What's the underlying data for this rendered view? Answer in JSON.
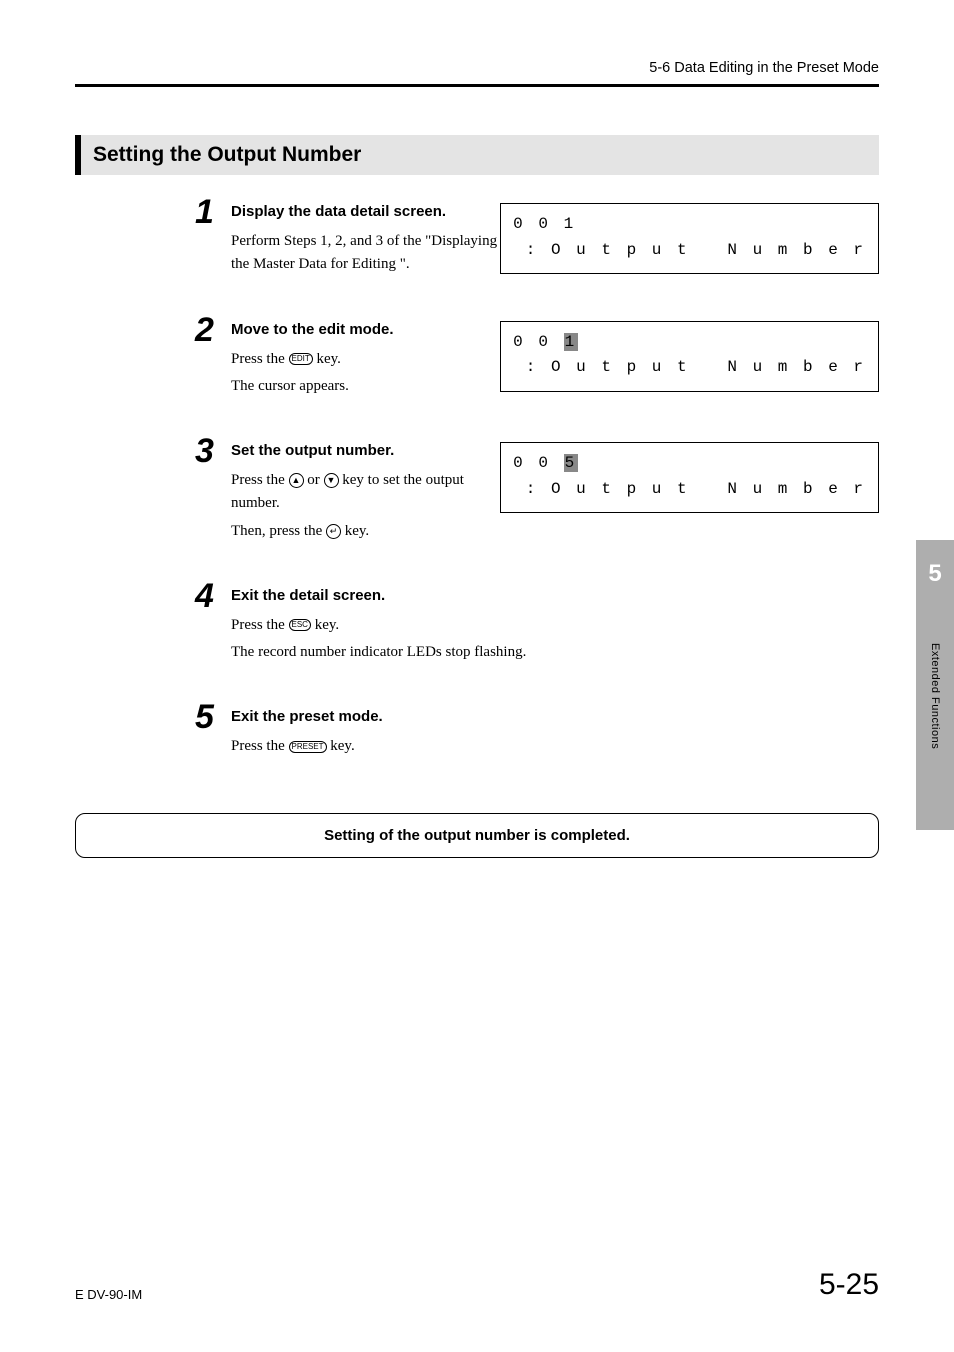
{
  "header": {
    "chapter_label": "5-6  Data Editing in the Preset Mode"
  },
  "section": {
    "title": "Setting the Output Number"
  },
  "steps": [
    {
      "num": "1",
      "heading": "Display the data detail screen.",
      "lines": [
        "Perform Steps 1, 2, and 3 of the \"Displaying the Master Data for Editing \"."
      ],
      "lcd": {
        "line1_a": "0 0 1",
        "line1_cursor": "",
        "line2": " : O u t p u t   N u m b e r"
      }
    },
    {
      "num": "2",
      "heading": "Move to the edit mode.",
      "key1_label": "EDIT",
      "line_a": "Press the ",
      "line_b": " key.",
      "line2": "The cursor appears.",
      "lcd": {
        "line1_a": "0 0 ",
        "line1_cursor": "1",
        "line2": " : O u t p u t   N u m b e r"
      }
    },
    {
      "num": "3",
      "heading": "Set the output number.",
      "line_a": "Press the ",
      "line_mid": " or ",
      "line_b": " key to set the output number.",
      "line2_a": "Then, press the ",
      "line2_b": " key.",
      "lcd": {
        "line1_a": "0 0 ",
        "line1_cursor": "5",
        "line2": " : O u t p u t   N u m b e r"
      }
    },
    {
      "num": "4",
      "heading": "Exit the detail screen.",
      "key1_label": "ESC",
      "line_a": "Press the ",
      "line_b": " key.",
      "line2": "The record number indicator LEDs stop flashing."
    },
    {
      "num": "5",
      "heading": "Exit the preset mode.",
      "key1_label": "PRESET",
      "line_a": "Press the ",
      "line_b": " key."
    }
  ],
  "completion": "Setting of the output number is completed.",
  "sidetab": {
    "num": "5",
    "text": "Extended Functions"
  },
  "footer": {
    "left": "E DV-90-IM",
    "right": "5-25"
  }
}
